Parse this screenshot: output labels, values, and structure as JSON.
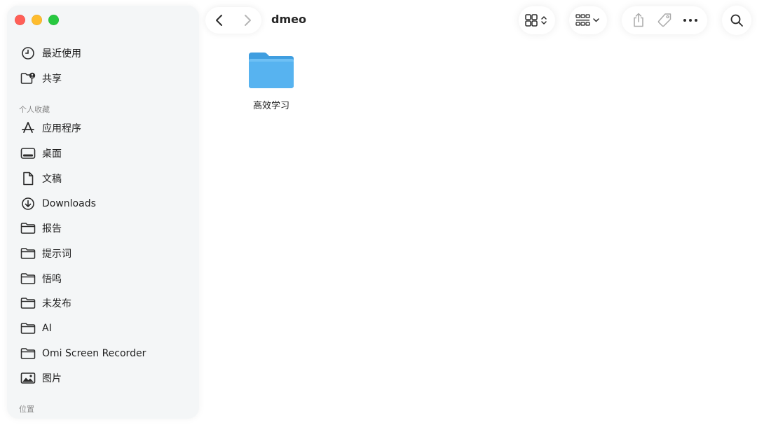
{
  "window": {
    "path_title": "dmeo"
  },
  "sidebar": {
    "top_items": [
      {
        "label": "最近使用",
        "icon": "clock-icon"
      },
      {
        "label": "共享",
        "icon": "shared-folder-icon"
      }
    ],
    "favorites_header": "个人收藏",
    "favorites": [
      {
        "label": "应用程序",
        "icon": "applications-icon"
      },
      {
        "label": "桌面",
        "icon": "desktop-icon"
      },
      {
        "label": "文稿",
        "icon": "document-icon"
      },
      {
        "label": "Downloads",
        "icon": "download-icon"
      },
      {
        "label": "报告",
        "icon": "folder-icon"
      },
      {
        "label": "提示词",
        "icon": "folder-icon"
      },
      {
        "label": "悟鸣",
        "icon": "folder-icon"
      },
      {
        "label": "未发布",
        "icon": "folder-icon"
      },
      {
        "label": "AI",
        "icon": "folder-icon"
      },
      {
        "label": "Omi Screen Recorder",
        "icon": "folder-icon"
      },
      {
        "label": "图片",
        "icon": "photo-icon"
      }
    ],
    "locations_header": "位置"
  },
  "toolbar": {
    "back_icon": "chevron-left-icon",
    "forward_icon": "chevron-right-icon",
    "view_icon": "grid-view-icon",
    "group_icon": "group-icon",
    "share_icon": "share-icon",
    "tag_icon": "tag-icon",
    "more_icon": "more-icon",
    "search_icon": "search-icon"
  },
  "content": {
    "items": [
      {
        "label": "高效学习",
        "type": "folder",
        "color": "#4aa8e8"
      }
    ]
  },
  "colors": {
    "close": "#ff5f57",
    "minimize": "#febc2e",
    "maximize": "#28c840",
    "folder": "#4aa8e8",
    "sidebar_bg": "#f4f6f7"
  }
}
